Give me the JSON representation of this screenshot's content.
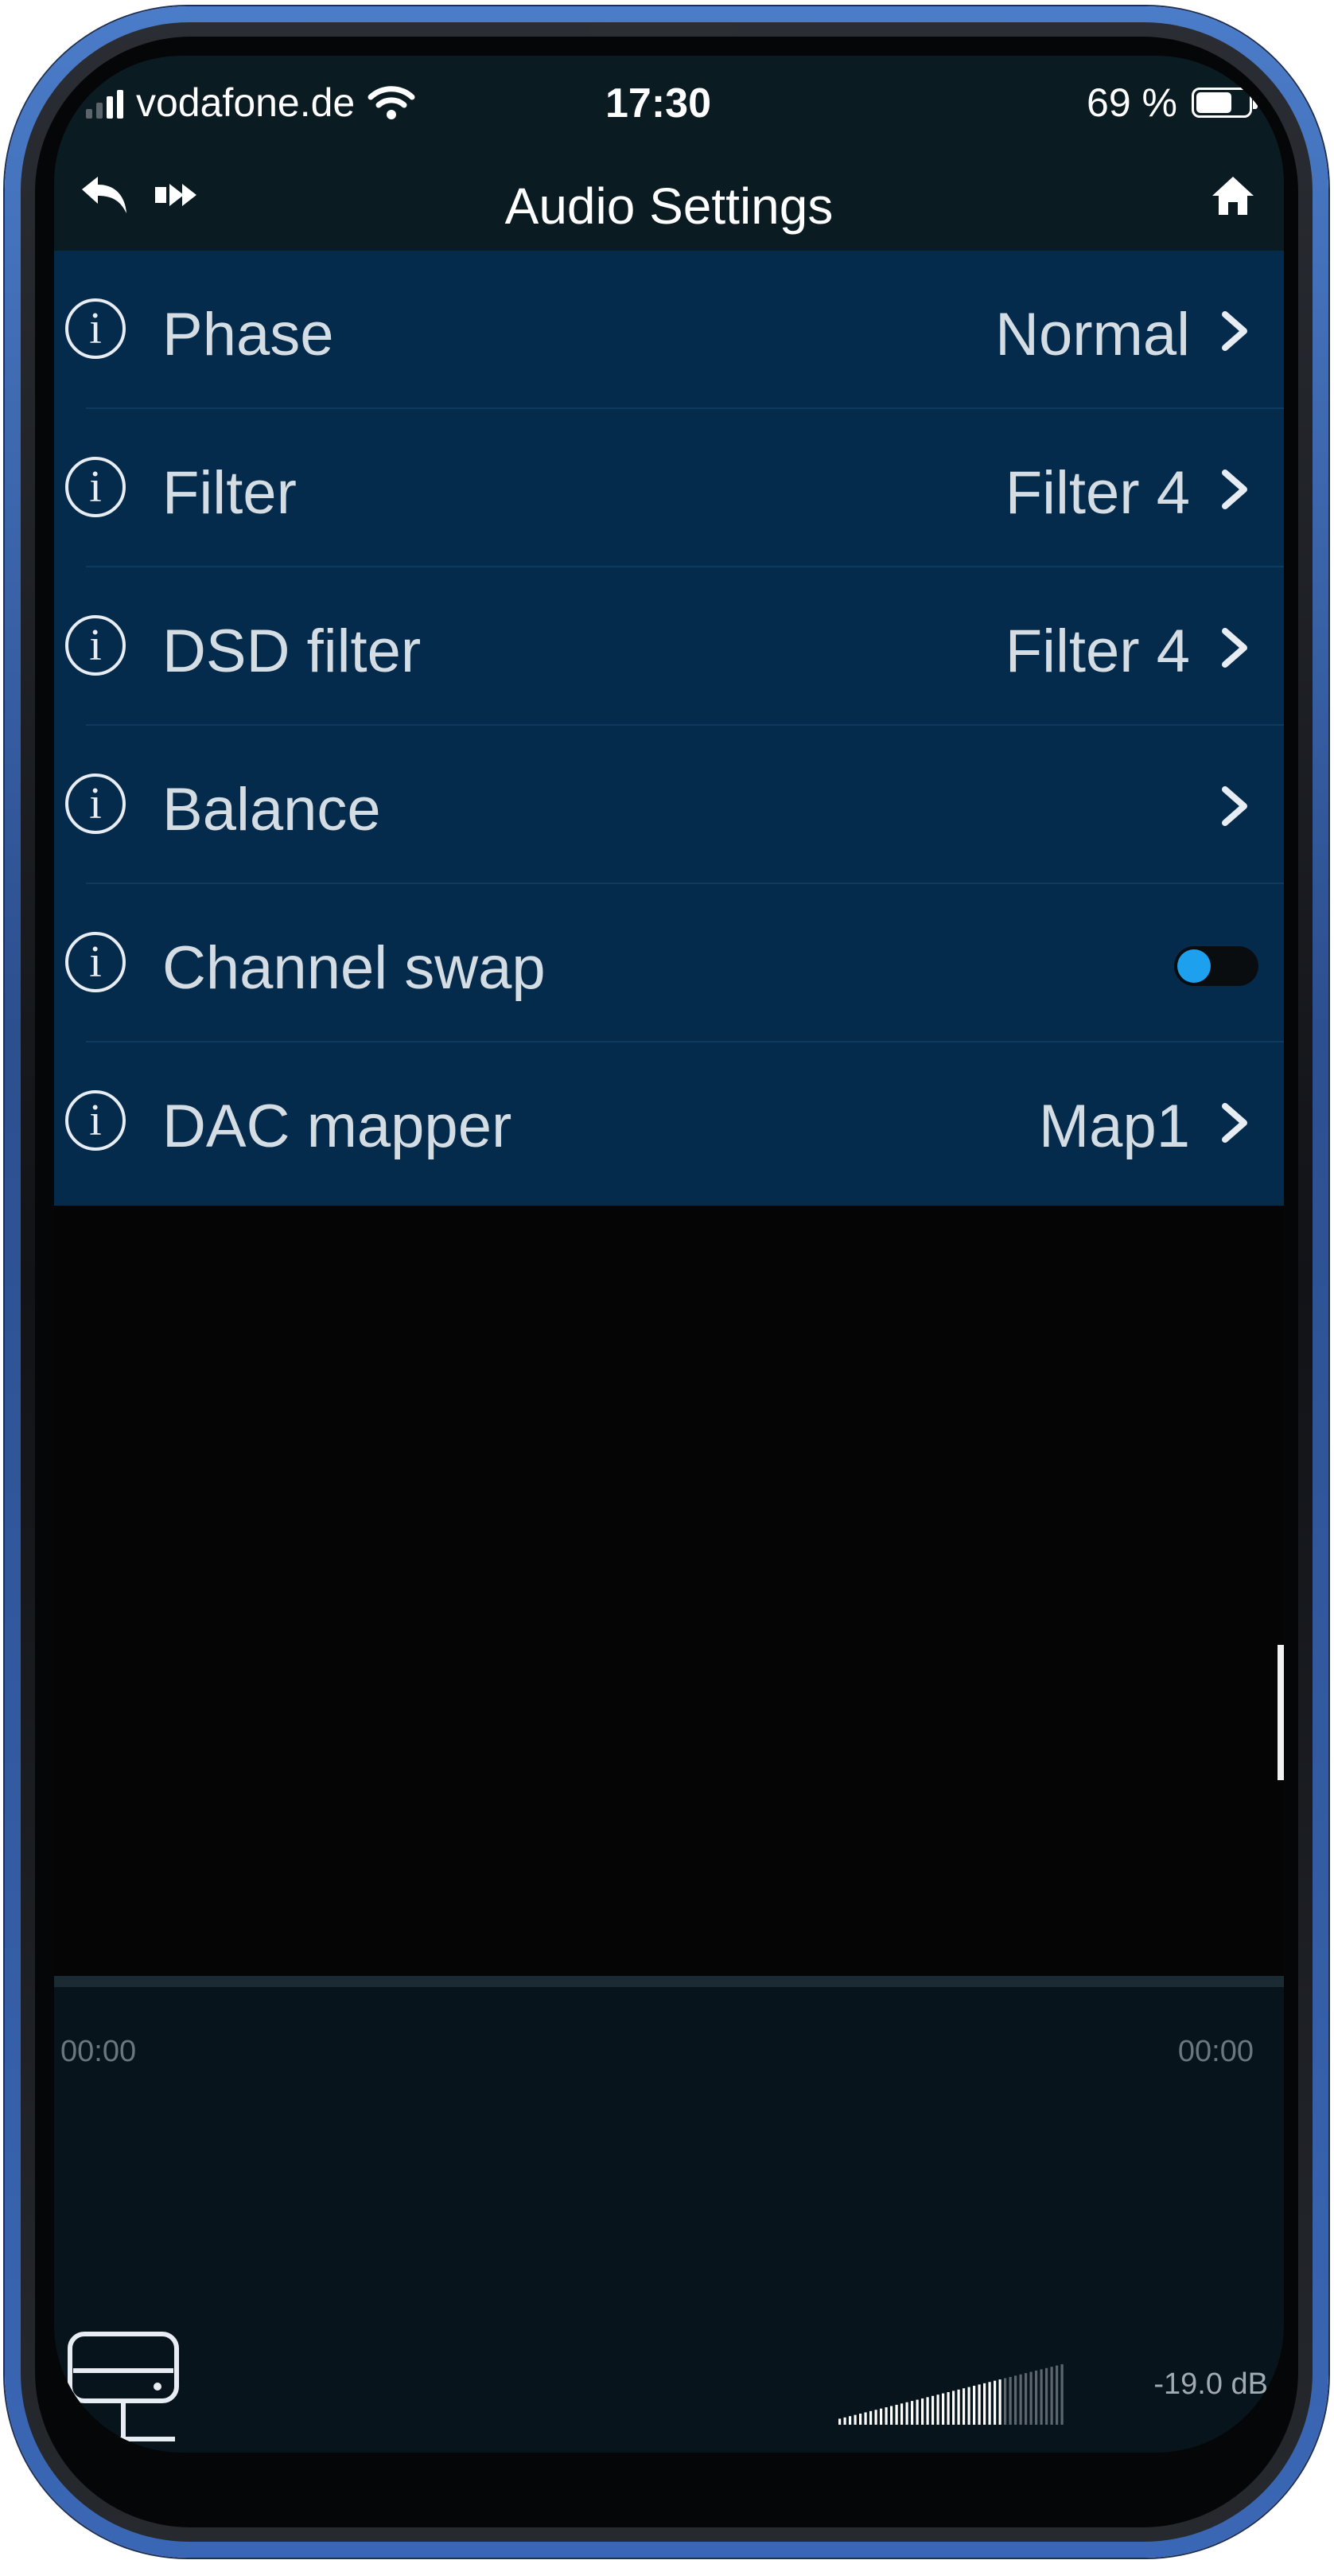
{
  "status_bar": {
    "carrier": "vodafone.de",
    "time": "17:30",
    "battery_percent": "69 %",
    "battery_level": 0.69,
    "icons": [
      "signal-icon",
      "wifi-icon",
      "battery-icon"
    ]
  },
  "nav": {
    "title": "Audio Settings",
    "icons": [
      "back-arrow-icon",
      "forward-icon",
      "home-icon"
    ]
  },
  "settings": [
    {
      "label": "Phase",
      "value": "Normal",
      "control": "chevron"
    },
    {
      "label": "Filter",
      "value": "Filter 4",
      "control": "chevron"
    },
    {
      "label": "DSD filter",
      "value": "Filter 4",
      "control": "chevron"
    },
    {
      "label": "Balance",
      "value": "",
      "control": "chevron"
    },
    {
      "label": "Channel swap",
      "value": "",
      "control": "toggle",
      "toggle_on": false
    },
    {
      "label": "DAC mapper",
      "value": "Map1",
      "control": "chevron"
    }
  ],
  "player": {
    "elapsed": "00:00",
    "remaining": "00:00",
    "volume": "-19.0 dB",
    "volume_level": 0.55
  },
  "colors": {
    "list_background": "#052b4c",
    "header_background": "#0b1b22",
    "toggle_accent": "#1da1ef",
    "phone_frame": "#3a67b5"
  }
}
